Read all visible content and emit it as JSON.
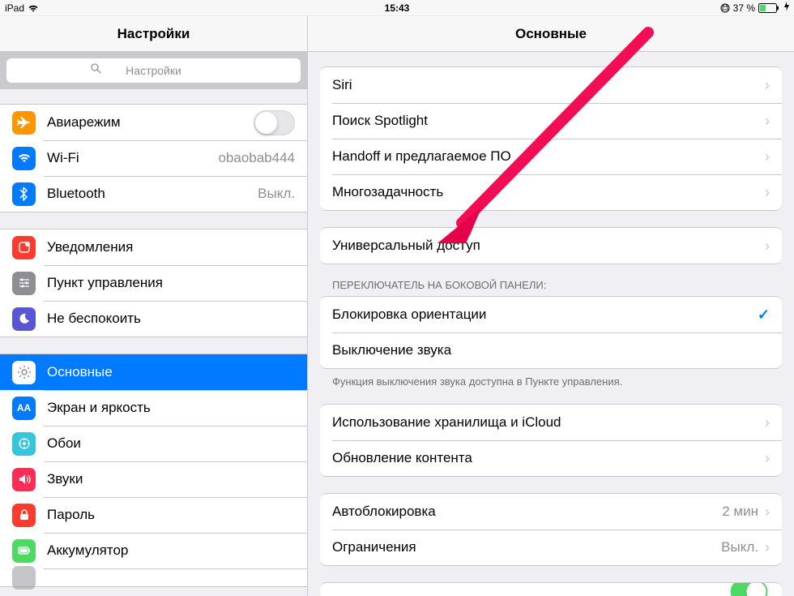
{
  "status": {
    "device": "iPad",
    "time": "15:43",
    "battery_pct": "37 %"
  },
  "sidebar": {
    "title": "Настройки",
    "search_placeholder": "Настройки",
    "items": [
      {
        "label": "Авиарежим"
      },
      {
        "label": "Wi-Fi",
        "value": "obaobab444"
      },
      {
        "label": "Bluetooth",
        "value": "Выкл."
      },
      {
        "label": "Уведомления"
      },
      {
        "label": "Пункт управления"
      },
      {
        "label": "Не беспокоить"
      },
      {
        "label": "Основные"
      },
      {
        "label": "Экран и яркость"
      },
      {
        "label": "Обои"
      },
      {
        "label": "Звуки"
      },
      {
        "label": "Пароль"
      },
      {
        "label": "Аккумулятор"
      }
    ]
  },
  "detail": {
    "title": "Основные",
    "group1": [
      {
        "label": "Siri"
      },
      {
        "label": "Поиск Spotlight"
      },
      {
        "label": "Handoff и предлагаемое ПО"
      },
      {
        "label": "Многозадачность"
      }
    ],
    "group2": [
      {
        "label": "Универсальный доступ"
      }
    ],
    "side_switch_header": "ПЕРЕКЛЮЧАТЕЛЬ НА БОКОВОЙ ПАНЕЛИ:",
    "group3": [
      {
        "label": "Блокировка ориентации",
        "checked": true
      },
      {
        "label": "Выключение звука",
        "checked": false
      }
    ],
    "side_switch_footer": "Функция выключения звука доступна в Пункте управления.",
    "group4": [
      {
        "label": "Использование хранилища и iCloud"
      },
      {
        "label": "Обновление контента"
      }
    ],
    "group5": [
      {
        "label": "Автоблокировка",
        "value": "2 мин"
      },
      {
        "label": "Ограничения",
        "value": "Выкл."
      }
    ]
  }
}
